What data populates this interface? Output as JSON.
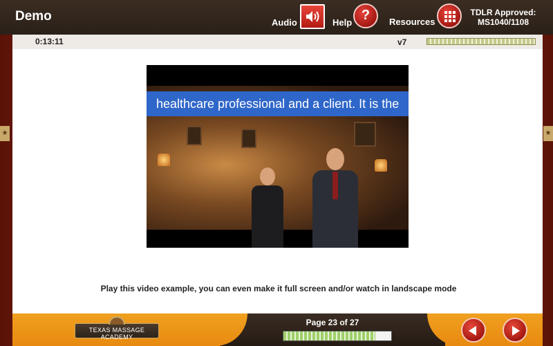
{
  "header": {
    "title": "Demo",
    "audio_label": "Audio",
    "help_label": "Help",
    "help_glyph": "?",
    "resources_label": "Resources",
    "approval_line1": "TDLR Approved:",
    "approval_line2": "MS1040/1108"
  },
  "status_bar": {
    "timer": "0:13:11",
    "version": "v7"
  },
  "video": {
    "caption": "healthcare professional and a client. It is the"
  },
  "main": {
    "instruction": "Play this video example, you can even make it full screen and/or watch in landscape mode"
  },
  "footer": {
    "logo_text": "TEXAS MASSAGE ACADEMY",
    "page_label": "Page 23 of 27",
    "progress_fraction": 0.85
  },
  "colors": {
    "accent_red": "#c81e16",
    "footer_orange": "#f0a020",
    "header_dark": "#2a2018",
    "caption_blue": "#2f66c9"
  },
  "icons": {
    "audio": "speaker-icon",
    "help": "question-icon",
    "resources": "grid-icon",
    "prev": "arrow-left-icon",
    "next": "arrow-right-icon",
    "side": "star-icon"
  }
}
